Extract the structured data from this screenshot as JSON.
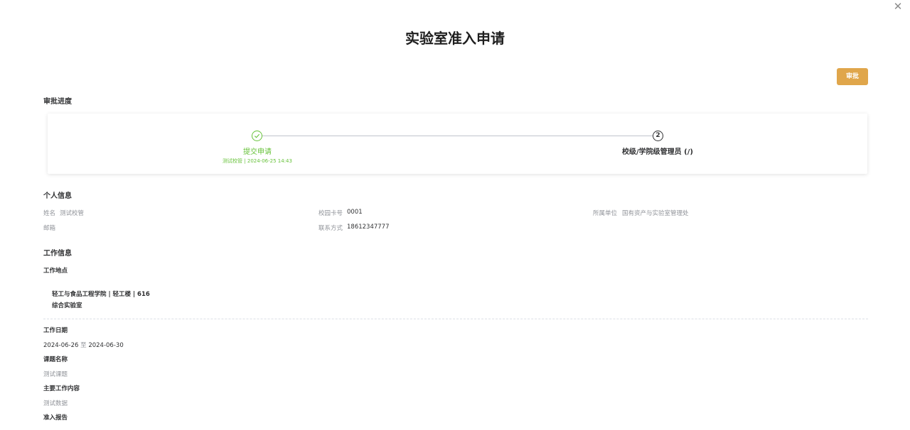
{
  "header": {
    "title": "实验室准入申请",
    "close_icon": "close-icon",
    "approve_label": "审批"
  },
  "progress": {
    "title": "审批进度",
    "steps": [
      {
        "title": "提交申请",
        "status": "done",
        "icon": "check-icon",
        "submitter": "测试校管",
        "separator": "|",
        "time": "2024-06-25 14:43"
      },
      {
        "title": "校级/学院级管理员 (/)",
        "status": "current",
        "number": "2"
      }
    ],
    "colors": {
      "done": "#67c23a",
      "current": "#303133"
    }
  },
  "personal": {
    "title": "个人信息",
    "name_label": "姓名",
    "name_value": "测试校管",
    "card_label": "校园卡号",
    "card_value": "0001",
    "unit_label": "所属单位",
    "unit_value": "国有资产与实验室管理处",
    "email_label": "邮箱",
    "email_value": "",
    "contact_label": "联系方式",
    "contact_value": "18612347777"
  },
  "work": {
    "title": "工作信息",
    "location_label": "工作地点",
    "location_line1": "轻工与食品工程学院 | 轻工楼 | 616",
    "location_line2": "综合实验室",
    "date_label": "工作日期",
    "date_start": "2024-06-26",
    "date_sep": "至",
    "date_end": "2024-06-30",
    "topic_label": "课题名称",
    "topic_value": "测试课题",
    "content_label": "主要工作内容",
    "content_value": "测试数据",
    "report_label": "准入报告"
  },
  "colors": {
    "accent": "#e0a64b",
    "success": "#67c23a",
    "link": "#3a6fd8"
  }
}
